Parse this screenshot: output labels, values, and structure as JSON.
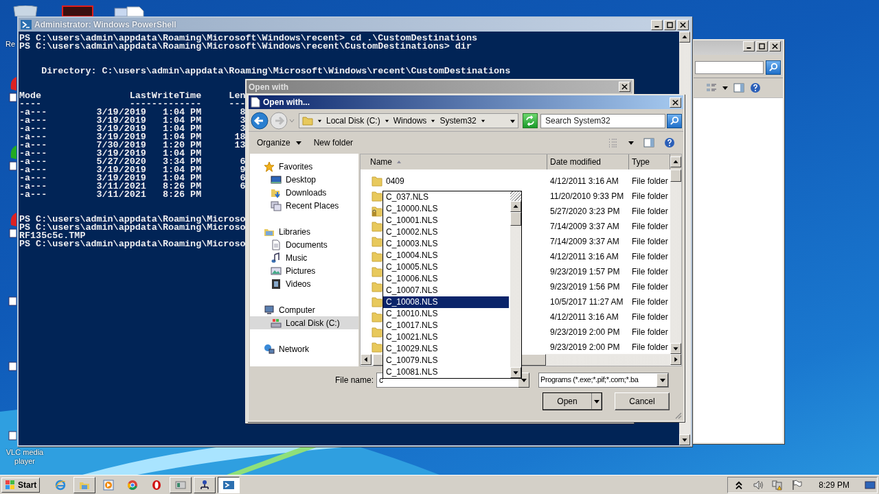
{
  "desktop_icons": [
    {
      "label": "Re",
      "kind": "bin"
    },
    {
      "label": "VLC media player",
      "kind": "shortcut"
    }
  ],
  "powershell": {
    "title": "Administrator: Windows PowerShell",
    "blocks": [
      [
        "PS C:\\users\\admin\\appdata\\Roaming\\Microsoft\\Windows\\recent> cd .\\CustomDestinations",
        "PS C:\\users\\admin\\appdata\\Roaming\\Microsoft\\Windows\\recent\\CustomDestinations> dir"
      ],
      [
        "    Directory: C:\\users\\admin\\appdata\\Roaming\\Microsoft\\Windows\\recent\\CustomDestinations"
      ],
      [
        "Mode                LastWriteTime     Len",
        "----                -------------     ---",
        "-a---         3/19/2019   1:04 PM       8",
        "-a---         3/19/2019   1:04 PM       3",
        "-a---         3/19/2019   1:04 PM       3",
        "-a---         3/19/2019   1:04 PM      18",
        "-a---         7/30/2019   1:20 PM      13",
        "-a---         3/19/2019   1:04 PM",
        "-a---         5/27/2020   3:34 PM       6",
        "-a---         3/19/2019   1:04 PM       9",
        "-a---         3/19/2019   1:04 PM       6",
        "-a---         3/11/2021   8:26 PM       6",
        "-a---         3/11/2021   8:26 PM"
      ],
      [
        "PS C:\\users\\admin\\appdata\\Roaming\\Microso",
        "PS C:\\users\\admin\\appdata\\Roaming\\Microso",
        "RF135c5c.TMP",
        "PS C:\\users\\admin\\appdata\\Roaming\\Microso"
      ]
    ]
  },
  "back_window": {
    "title": "Open with"
  },
  "dialog": {
    "title": "Open with...",
    "breadcrumbs": [
      "Local Disk (C:)",
      "Windows",
      "System32"
    ],
    "search": {
      "placeholder": "Search System32"
    },
    "toolbar": [
      {
        "label": "Organize",
        "menu": true
      },
      {
        "label": "New folder",
        "menu": false
      }
    ],
    "nav": [
      {
        "label": "Favorites",
        "kind": "star",
        "selected": false,
        "children": [
          {
            "label": "Desktop",
            "kind": "desktop",
            "selected": false
          },
          {
            "label": "Downloads",
            "kind": "downloads",
            "selected": false
          },
          {
            "label": "Recent Places",
            "kind": "recent",
            "selected": false
          }
        ]
      },
      {
        "label": "Libraries",
        "kind": "library",
        "selected": false,
        "children": [
          {
            "label": "Documents",
            "kind": "document",
            "selected": false
          },
          {
            "label": "Music",
            "kind": "music",
            "selected": false
          },
          {
            "label": "Pictures",
            "kind": "pictures",
            "selected": false
          },
          {
            "label": "Videos",
            "kind": "videos",
            "selected": false
          }
        ]
      },
      {
        "label": "Computer",
        "kind": "computer",
        "selected": false,
        "children": [
          {
            "label": "Local Disk (C:)",
            "kind": "drive",
            "selected": true
          }
        ]
      },
      {
        "label": "Network",
        "kind": "network",
        "selected": false
      }
    ],
    "columns": [
      {
        "label": "Name",
        "sorted": true
      },
      {
        "label": "Date modified",
        "sorted": false
      },
      {
        "label": "Type",
        "sorted": false
      }
    ],
    "rows": [
      {
        "name": "0409",
        "locked": false,
        "date": "4/12/2011 3:16 AM",
        "type": "File folder"
      },
      {
        "locked": false,
        "date": "11/20/2010 9:33 PM",
        "type": "File folder"
      },
      {
        "locked": true,
        "date": "5/27/2020 3:23 PM",
        "type": "File folder"
      },
      {
        "locked": false,
        "date": "7/14/2009 3:37 AM",
        "type": "File folder"
      },
      {
        "locked": false,
        "date": "7/14/2009 3:37 AM",
        "type": "File folder"
      },
      {
        "locked": false,
        "date": "4/12/2011 3:16 AM",
        "type": "File folder"
      },
      {
        "locked": false,
        "date": "9/23/2019 1:57 PM",
        "type": "File folder"
      },
      {
        "locked": false,
        "date": "9/23/2019 1:56 PM",
        "type": "File folder"
      },
      {
        "locked": false,
        "date": "10/5/2017 11:27 AM",
        "type": "File folder"
      },
      {
        "locked": false,
        "date": "4/12/2011 3:16 AM",
        "type": "File folder"
      },
      {
        "locked": false,
        "date": "9/23/2019 2:00 PM",
        "type": "File folder"
      },
      {
        "locked": false,
        "date": "9/23/2019 2:00 PM",
        "type": "File folder"
      }
    ],
    "suggestions": [
      {
        "label": "C_037.NLS",
        "selected": false
      },
      {
        "label": "C_10000.NLS",
        "selected": false
      },
      {
        "label": "C_10001.NLS",
        "selected": false
      },
      {
        "label": "C_10002.NLS",
        "selected": false
      },
      {
        "label": "C_10003.NLS",
        "selected": false
      },
      {
        "label": "C_10004.NLS",
        "selected": false
      },
      {
        "label": "C_10005.NLS",
        "selected": false
      },
      {
        "label": "C_10006.NLS",
        "selected": false
      },
      {
        "label": "C_10007.NLS",
        "selected": false
      },
      {
        "label": "C_10008.NLS",
        "selected": true
      },
      {
        "label": "C_10010.NLS",
        "selected": false
      },
      {
        "label": "C_10017.NLS",
        "selected": false
      },
      {
        "label": "C_10021.NLS",
        "selected": false
      },
      {
        "label": "C_10029.NLS",
        "selected": false
      },
      {
        "label": "C_10079.NLS",
        "selected": false
      },
      {
        "label": "C_10081.NLS",
        "selected": false
      }
    ],
    "file_name": {
      "label": "File name:",
      "value": "c"
    },
    "filter": "Programs (*.exe;*.pif;*.com;*.ba",
    "buttons": [
      {
        "label": "Open",
        "split": true
      },
      {
        "label": "Cancel",
        "split": false
      }
    ]
  },
  "taskbar": {
    "start": "Start",
    "apps": [
      {
        "kind": "ie",
        "running": false,
        "selected": false
      },
      {
        "kind": "explorer",
        "running": true,
        "selected": false
      },
      {
        "kind": "media",
        "running": false,
        "selected": false
      },
      {
        "kind": "chrome",
        "running": false,
        "selected": false
      },
      {
        "kind": "opera",
        "running": false,
        "selected": false
      },
      {
        "kind": "app",
        "running": true,
        "selected": false
      },
      {
        "kind": "network",
        "running": true,
        "selected": false
      },
      {
        "kind": "powershell",
        "running": true,
        "selected": true
      }
    ],
    "clock": "8:29 PM"
  }
}
